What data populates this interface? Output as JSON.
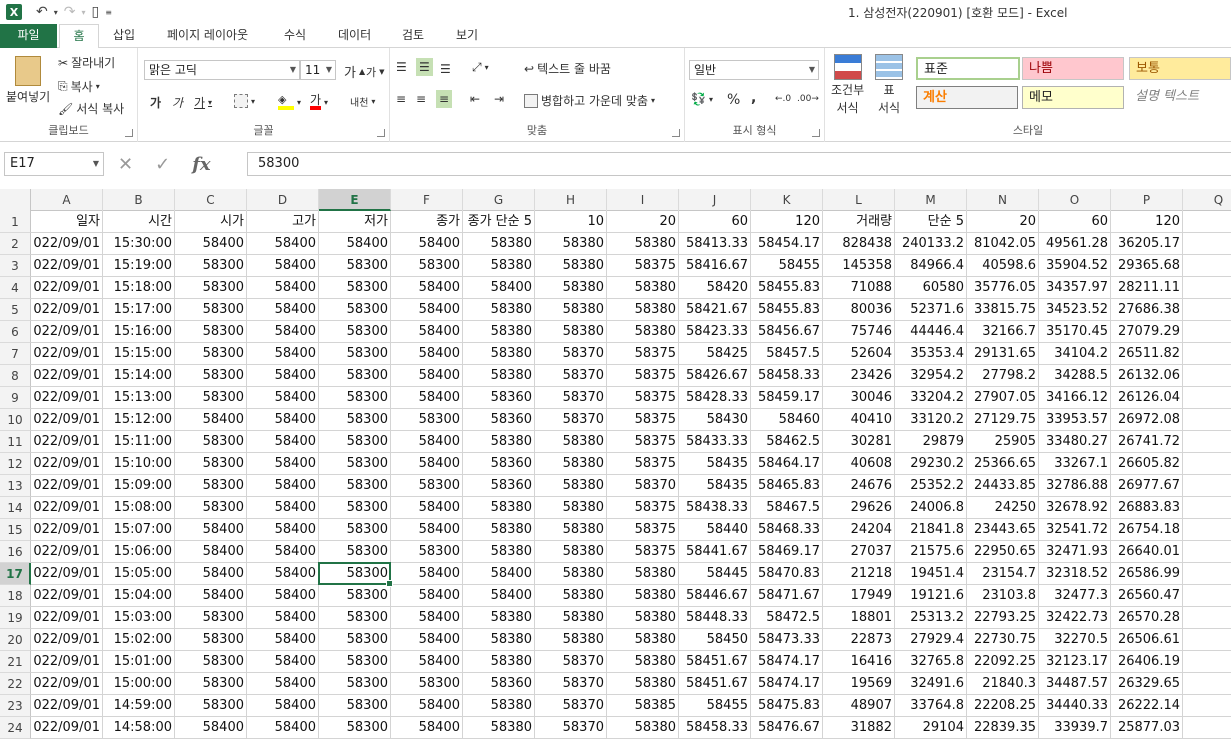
{
  "window": {
    "title": "1. 삼성전자(220901)  [호환 모드] - Excel"
  },
  "menu": {
    "file": "파일",
    "tabs": [
      "홈",
      "삽입",
      "페이지 레이아웃",
      "수식",
      "데이터",
      "검토",
      "보기"
    ],
    "active": "홈"
  },
  "ribbon": {
    "clipboard": {
      "paste": "붙여넣기",
      "cut": "잘라내기",
      "copy": "복사",
      "format_painter": "서식 복사",
      "label": "클립보드"
    },
    "font": {
      "name": "맑은 고딕",
      "size": "11",
      "bold": "가",
      "italic": "가",
      "underline": "가",
      "grow": "가",
      "shrink": "가",
      "font_color": "가",
      "phonetic": "내천",
      "label": "글꼴"
    },
    "alignment": {
      "wrap": "텍스트 줄 바꿈",
      "merge": "병합하고 가운데 맞춤",
      "label": "맞춤"
    },
    "number": {
      "format": "일반",
      "percent": "%",
      "comma": ",",
      "label": "표시 형식"
    },
    "styles": {
      "conditional": "조건부",
      "conditional2": "서식",
      "table": "표",
      "table2": "서식",
      "normal": "표준",
      "bad": "나쁨",
      "neutral": "보통",
      "calculation": "계산",
      "note": "메모",
      "explanatory": "설명 텍스트",
      "label": "스타일"
    }
  },
  "formula_bar": {
    "name_box": "E17",
    "value": "58300"
  },
  "sheet": {
    "columns": [
      "A",
      "B",
      "C",
      "D",
      "E",
      "F",
      "G",
      "H",
      "I",
      "J",
      "K",
      "L",
      "M",
      "N",
      "O",
      "P",
      "Q"
    ],
    "selected_col": "E",
    "selected_row": 17,
    "header_row": [
      "일자",
      "시간",
      "시가",
      "고가",
      "저가",
      "종가",
      "종가 단순 5",
      "10",
      "20",
      "60",
      "120",
      "거래량",
      "단순 5",
      "20",
      "60",
      "120",
      ""
    ],
    "rows": [
      [
        "022/09/01",
        "15:30:00",
        "58400",
        "58400",
        "58400",
        "58400",
        "58380",
        "58380",
        "58380",
        "58413.33",
        "58454.17",
        "828438",
        "240133.2",
        "81042.05",
        "49561.28",
        "36205.17"
      ],
      [
        "022/09/01",
        "15:19:00",
        "58300",
        "58400",
        "58300",
        "58300",
        "58380",
        "58380",
        "58375",
        "58416.67",
        "58455",
        "145358",
        "84966.4",
        "40598.6",
        "35904.52",
        "29365.68"
      ],
      [
        "022/09/01",
        "15:18:00",
        "58300",
        "58400",
        "58300",
        "58400",
        "58400",
        "58380",
        "58380",
        "58420",
        "58455.83",
        "71088",
        "60580",
        "35776.05",
        "34357.97",
        "28211.11"
      ],
      [
        "022/09/01",
        "15:17:00",
        "58300",
        "58400",
        "58300",
        "58400",
        "58380",
        "58380",
        "58380",
        "58421.67",
        "58455.83",
        "80036",
        "52371.6",
        "33815.75",
        "34523.52",
        "27686.38"
      ],
      [
        "022/09/01",
        "15:16:00",
        "58300",
        "58400",
        "58300",
        "58400",
        "58380",
        "58380",
        "58380",
        "58423.33",
        "58456.67",
        "75746",
        "44446.4",
        "32166.7",
        "35170.45",
        "27079.29"
      ],
      [
        "022/09/01",
        "15:15:00",
        "58300",
        "58400",
        "58300",
        "58400",
        "58380",
        "58370",
        "58375",
        "58425",
        "58457.5",
        "52604",
        "35353.4",
        "29131.65",
        "34104.2",
        "26511.82"
      ],
      [
        "022/09/01",
        "15:14:00",
        "58300",
        "58400",
        "58300",
        "58400",
        "58380",
        "58370",
        "58375",
        "58426.67",
        "58458.33",
        "23426",
        "32954.2",
        "27798.2",
        "34288.5",
        "26132.06"
      ],
      [
        "022/09/01",
        "15:13:00",
        "58300",
        "58400",
        "58300",
        "58400",
        "58360",
        "58370",
        "58375",
        "58428.33",
        "58459.17",
        "30046",
        "33204.2",
        "27907.05",
        "34166.12",
        "26126.04"
      ],
      [
        "022/09/01",
        "15:12:00",
        "58400",
        "58400",
        "58300",
        "58300",
        "58360",
        "58370",
        "58375",
        "58430",
        "58460",
        "40410",
        "33120.2",
        "27129.75",
        "33953.57",
        "26972.08"
      ],
      [
        "022/09/01",
        "15:11:00",
        "58300",
        "58400",
        "58300",
        "58400",
        "58380",
        "58380",
        "58375",
        "58433.33",
        "58462.5",
        "30281",
        "29879",
        "25905",
        "33480.27",
        "26741.72"
      ],
      [
        "022/09/01",
        "15:10:00",
        "58300",
        "58400",
        "58300",
        "58400",
        "58360",
        "58380",
        "58375",
        "58435",
        "58464.17",
        "40608",
        "29230.2",
        "25366.65",
        "33267.1",
        "26605.82"
      ],
      [
        "022/09/01",
        "15:09:00",
        "58300",
        "58400",
        "58300",
        "58300",
        "58360",
        "58380",
        "58370",
        "58435",
        "58465.83",
        "24676",
        "25352.2",
        "24433.85",
        "32786.88",
        "26977.67"
      ],
      [
        "022/09/01",
        "15:08:00",
        "58300",
        "58400",
        "58300",
        "58400",
        "58380",
        "58380",
        "58375",
        "58438.33",
        "58467.5",
        "29626",
        "24006.8",
        "24250",
        "32678.92",
        "26883.83"
      ],
      [
        "022/09/01",
        "15:07:00",
        "58400",
        "58400",
        "58300",
        "58400",
        "58380",
        "58380",
        "58375",
        "58440",
        "58468.33",
        "24204",
        "21841.8",
        "23443.65",
        "32541.72",
        "26754.18"
      ],
      [
        "022/09/01",
        "15:06:00",
        "58400",
        "58400",
        "58300",
        "58300",
        "58380",
        "58380",
        "58375",
        "58441.67",
        "58469.17",
        "27037",
        "21575.6",
        "22950.65",
        "32471.93",
        "26640.01"
      ],
      [
        "022/09/01",
        "15:05:00",
        "58400",
        "58400",
        "58300",
        "58400",
        "58400",
        "58380",
        "58380",
        "58445",
        "58470.83",
        "21218",
        "19451.4",
        "23154.7",
        "32318.52",
        "26586.99"
      ],
      [
        "022/09/01",
        "15:04:00",
        "58400",
        "58400",
        "58300",
        "58400",
        "58400",
        "58380",
        "58380",
        "58446.67",
        "58471.67",
        "17949",
        "19121.6",
        "23103.8",
        "32477.3",
        "26560.47"
      ],
      [
        "022/09/01",
        "15:03:00",
        "58300",
        "58400",
        "58300",
        "58400",
        "58380",
        "58380",
        "58380",
        "58448.33",
        "58472.5",
        "18801",
        "25313.2",
        "22793.25",
        "32422.73",
        "26570.28"
      ],
      [
        "022/09/01",
        "15:02:00",
        "58300",
        "58400",
        "58300",
        "58400",
        "58380",
        "58380",
        "58380",
        "58450",
        "58473.33",
        "22873",
        "27929.4",
        "22730.75",
        "32270.5",
        "26506.61"
      ],
      [
        "022/09/01",
        "15:01:00",
        "58300",
        "58400",
        "58300",
        "58400",
        "58380",
        "58370",
        "58380",
        "58451.67",
        "58474.17",
        "16416",
        "32765.8",
        "22092.25",
        "32123.17",
        "26406.19"
      ],
      [
        "022/09/01",
        "15:00:00",
        "58300",
        "58400",
        "58300",
        "58300",
        "58360",
        "58370",
        "58380",
        "58451.67",
        "58474.17",
        "19569",
        "32491.6",
        "21840.3",
        "34487.57",
        "26329.65"
      ],
      [
        "022/09/01",
        "14:59:00",
        "58300",
        "58400",
        "58300",
        "58400",
        "58380",
        "58370",
        "58385",
        "58455",
        "58475.83",
        "48907",
        "33764.8",
        "22208.25",
        "34440.33",
        "26222.14"
      ],
      [
        "022/09/01",
        "14:58:00",
        "58400",
        "58400",
        "58300",
        "58400",
        "58380",
        "58370",
        "58380",
        "58458.33",
        "58476.67",
        "31882",
        "29104",
        "22839.35",
        "33939.7",
        "25877.03"
      ]
    ]
  }
}
